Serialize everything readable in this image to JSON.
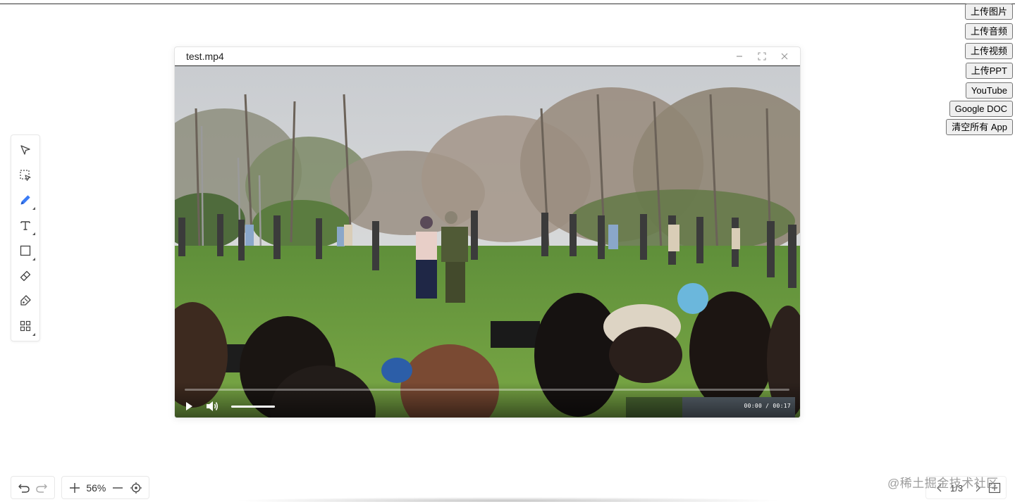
{
  "upload_buttons": {
    "image": "上传图片",
    "audio": "上传音频",
    "video": "上传视频",
    "ppt": "上传PPT",
    "youtube": "YouTube",
    "google_doc": "Google DOC",
    "clear_all": "清空所有 App"
  },
  "toolbar": {
    "tools": [
      "selector-icon",
      "area-select-icon",
      "pencil-icon",
      "text-icon",
      "rectangle-icon",
      "eraser-icon",
      "laser-pointer-icon",
      "apps-grid-icon"
    ],
    "active_tool": "pencil-icon",
    "accent_color": "#3b7cf6"
  },
  "app_window": {
    "title": "test.mp4",
    "controls": [
      "minimize-icon",
      "fullscreen-icon",
      "close-icon"
    ],
    "player": {
      "current_time": "00:00",
      "duration": "00:17",
      "time_display": "00:00 / 00:17",
      "progress": 0.0,
      "volume": 1.0
    }
  },
  "zoom": {
    "level": "56%"
  },
  "pager": {
    "current_page": "1/3"
  },
  "watermark": {
    "text": "@稀土掘金技术社区"
  }
}
